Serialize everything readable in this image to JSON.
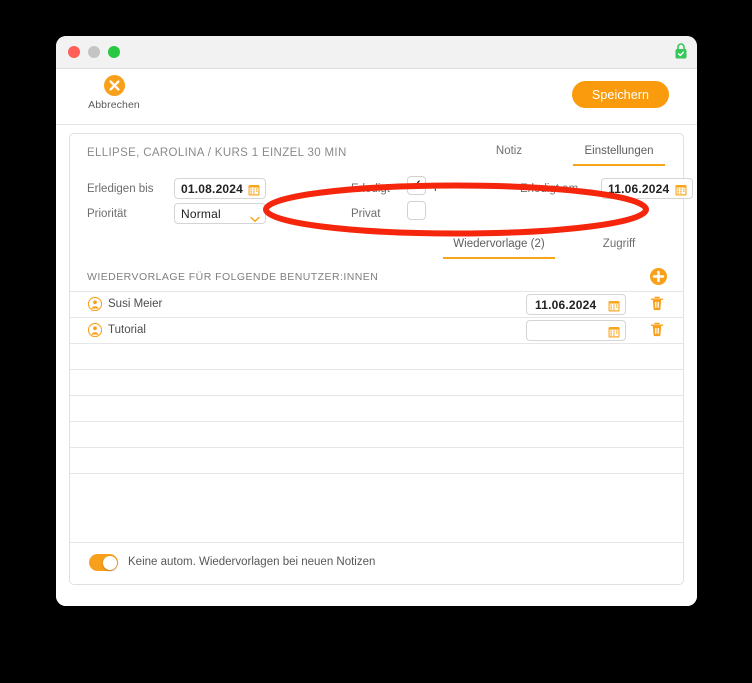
{
  "window": {
    "traffic_lights": [
      "close-button",
      "minimize-button",
      "zoom-button"
    ],
    "lock_icon": "lock-icon",
    "lock_color": "#34c759"
  },
  "toolbar": {
    "cancel_label": "Abbrechen",
    "cancel_icon": "circle-x-icon",
    "save_label": "Speichern",
    "accent_color": "#f99b0c"
  },
  "record": {
    "title": "ELLIPSE, CAROLINA / KURS 1 EINZEL 30 MIN"
  },
  "top_tabs": [
    {
      "label": "Notiz",
      "active": false
    },
    {
      "label": "Einstellungen",
      "active": true
    }
  ],
  "form": {
    "due_label": "Erledigen bis",
    "due_value": "01.08.2024",
    "priority_label": "Priorität",
    "priority_value": "Normal",
    "priority_options": [
      "Normal"
    ],
    "done_label": "Erledigt",
    "done_checked": "✓",
    "done_suffix": "T",
    "private_label": "Privat",
    "done_on_label": "Erledigt am",
    "done_on_value": "11.06.2024",
    "calendar_icon": "calendar-icon",
    "chevron_icon": "chevron-down-icon"
  },
  "second_tabs": [
    {
      "label": "Wiedervorlage (2)",
      "active": true
    },
    {
      "label": "Zugriff",
      "active": false
    }
  ],
  "section": {
    "title": "WIEDERVORLAGE FÜR FOLGENDE BENUTZER:INNEN",
    "add_icon": "plus-circle-icon"
  },
  "list_rows": [
    {
      "icon": "person-icon",
      "name": "Susi Meier",
      "date": "11.06.2024",
      "delete_icon": "trash-icon"
    },
    {
      "icon": "person-icon",
      "name": "Tutorial",
      "date": "",
      "delete_icon": "trash-icon"
    }
  ],
  "empty_row_count": 5,
  "footer": {
    "toggle_on": true,
    "toggle_label": "Keine autom. Wiedervorlagen bei neuen Notizen",
    "toggle_color": "#f7a01b"
  },
  "annotation": {
    "shape": "ellipse-highlight",
    "color": "#f5260b",
    "stroke_width": 6
  }
}
